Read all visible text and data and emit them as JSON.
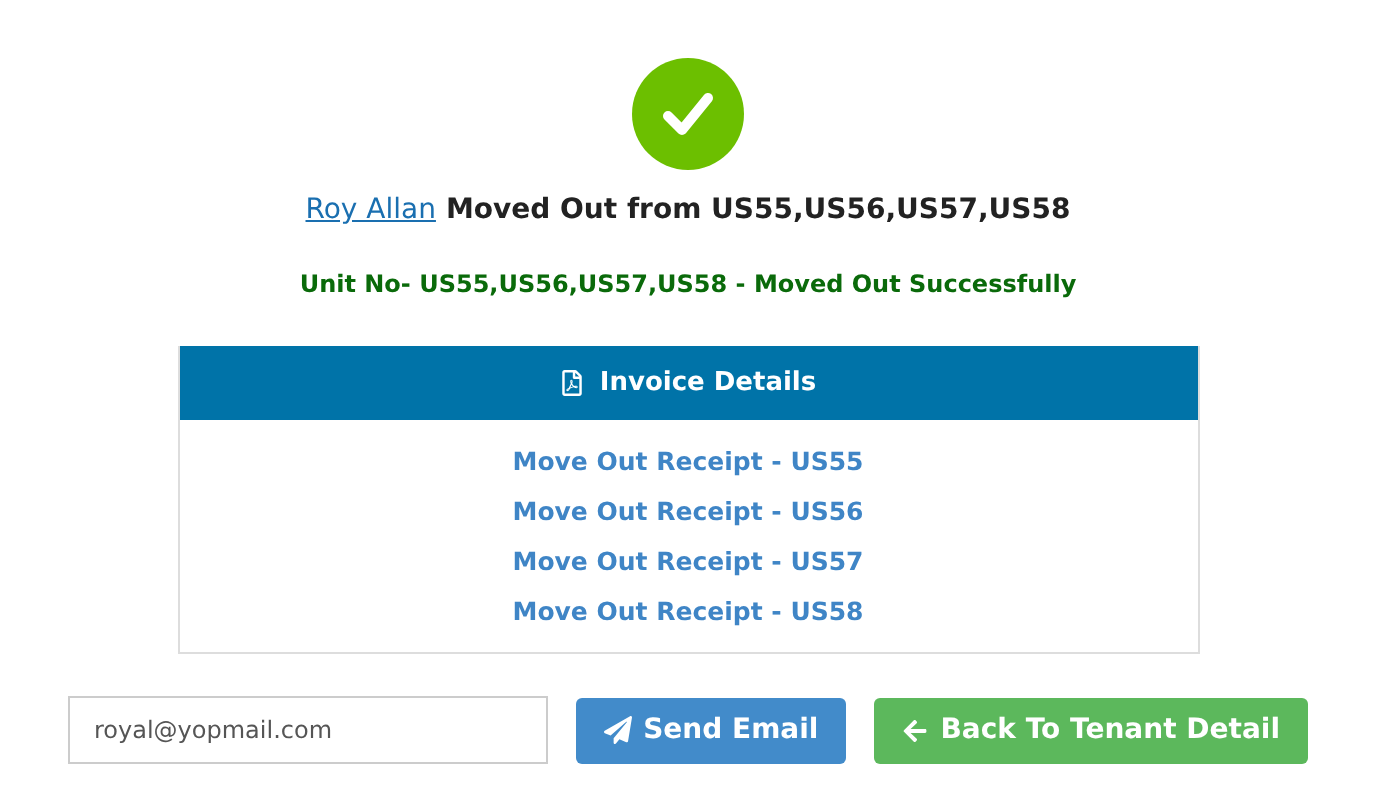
{
  "headline": {
    "tenant_link": "Roy Allan",
    "text": "Moved Out from US55,US56,US57,US58"
  },
  "success_message": "Unit No- US55,US56,US57,US58 - Moved Out Successfully",
  "invoice_panel": {
    "title": "Invoice Details",
    "receipts": [
      {
        "label": "Move Out Receipt - US55"
      },
      {
        "label": "Move Out Receipt - US56"
      },
      {
        "label": "Move Out Receipt - US57"
      },
      {
        "label": "Move Out Receipt - US58"
      }
    ]
  },
  "email_field": {
    "value": "royal@yopmail.com"
  },
  "buttons": [
    {
      "kind": "send",
      "label": "Send Email"
    },
    {
      "kind": "back",
      "label": "Back To Tenant Detail"
    }
  ]
}
